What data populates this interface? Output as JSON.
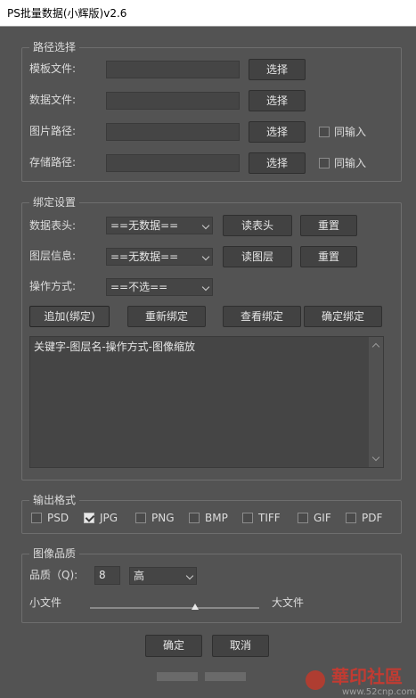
{
  "window": {
    "title": "PS批量数据(小辉版)v2.6"
  },
  "path_group": {
    "legend": "路径选择",
    "rows": [
      {
        "label": "模板文件:",
        "value": "",
        "button": "选择"
      },
      {
        "label": "数据文件:",
        "value": "",
        "button": "选择"
      },
      {
        "label": "图片路径:",
        "value": "",
        "button": "选择",
        "checkbox": "同输入",
        "checked": false
      },
      {
        "label": "存储路径:",
        "value": "",
        "button": "选择",
        "checkbox": "同输入",
        "checked": false
      }
    ]
  },
  "bind_group": {
    "legend": "绑定设置",
    "header_label": "数据表头:",
    "header_select": "==无数据==",
    "read_header_button": "读表头",
    "reset_button_1": "重置",
    "layer_label": "图层信息:",
    "layer_select": "==无数据==",
    "read_layer_button": "读图层",
    "reset_button_2": "重置",
    "op_label": "操作方式:",
    "op_select": "==不选==",
    "add_bind_button": "追加(绑定)",
    "rebind_button": "重新绑定",
    "view_bind_button": "查看绑定",
    "confirm_bind_button": "确定绑定",
    "textarea_text": "关键字-图层名-操作方式-图像缩放"
  },
  "format_group": {
    "legend": "输出格式",
    "formats": [
      {
        "label": "PSD",
        "checked": false
      },
      {
        "label": "JPG",
        "checked": true
      },
      {
        "label": "PNG",
        "checked": false
      },
      {
        "label": "BMP",
        "checked": false
      },
      {
        "label": "TIFF",
        "checked": false
      },
      {
        "label": "GIF",
        "checked": false
      },
      {
        "label": "PDF",
        "checked": false
      }
    ]
  },
  "quality_group": {
    "legend": "图像品质",
    "quality_label": "品质（Q):",
    "quality_value": "8",
    "quality_select": "高",
    "small_label": "小文件",
    "large_label": "大文件",
    "slider_fraction": 0.62
  },
  "footer": {
    "ok_button": "确定",
    "cancel_button": "取消"
  },
  "watermark": {
    "text": "華印社區",
    "url": "www.52cnp.com"
  },
  "colors": {
    "background": "#535353",
    "titlebar": "#ffffff",
    "watermark": "#c23b32"
  }
}
